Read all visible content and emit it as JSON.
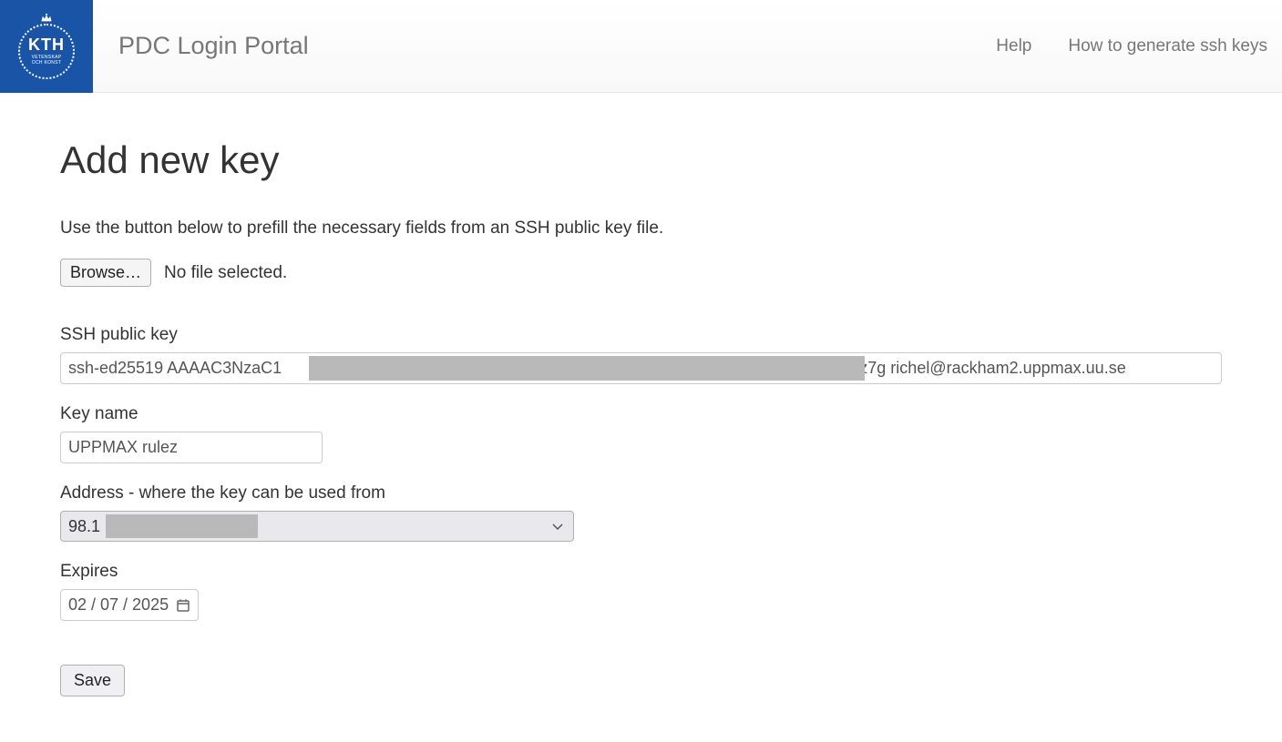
{
  "header": {
    "logo": {
      "main": "KTH",
      "sub1": "VETENSKAP",
      "sub2": "OCH KONST"
    },
    "brand": "PDC Login Portal",
    "nav": {
      "help": "Help",
      "howto": "How to generate ssh keys"
    }
  },
  "page": {
    "title": "Add new key",
    "instruction": "Use the button below to prefill the necessary fields from an SSH public key file.",
    "browse_label": "Browse…",
    "file_status": "No file selected."
  },
  "form": {
    "ssh_label": "SSH public key",
    "ssh_value": "ssh-ed25519 AAAAC3NzaC1                                                                                                                 6faiKkzqz7g richel@rackham2.uppmax.uu.se",
    "keyname_label": "Key name",
    "keyname_value": "UPPMAX rulez",
    "address_label": "Address - where the key can be used from",
    "address_value": "98.1",
    "expires_label": "Expires",
    "expires_value": "02 / 07 / 2025",
    "save_label": "Save"
  }
}
